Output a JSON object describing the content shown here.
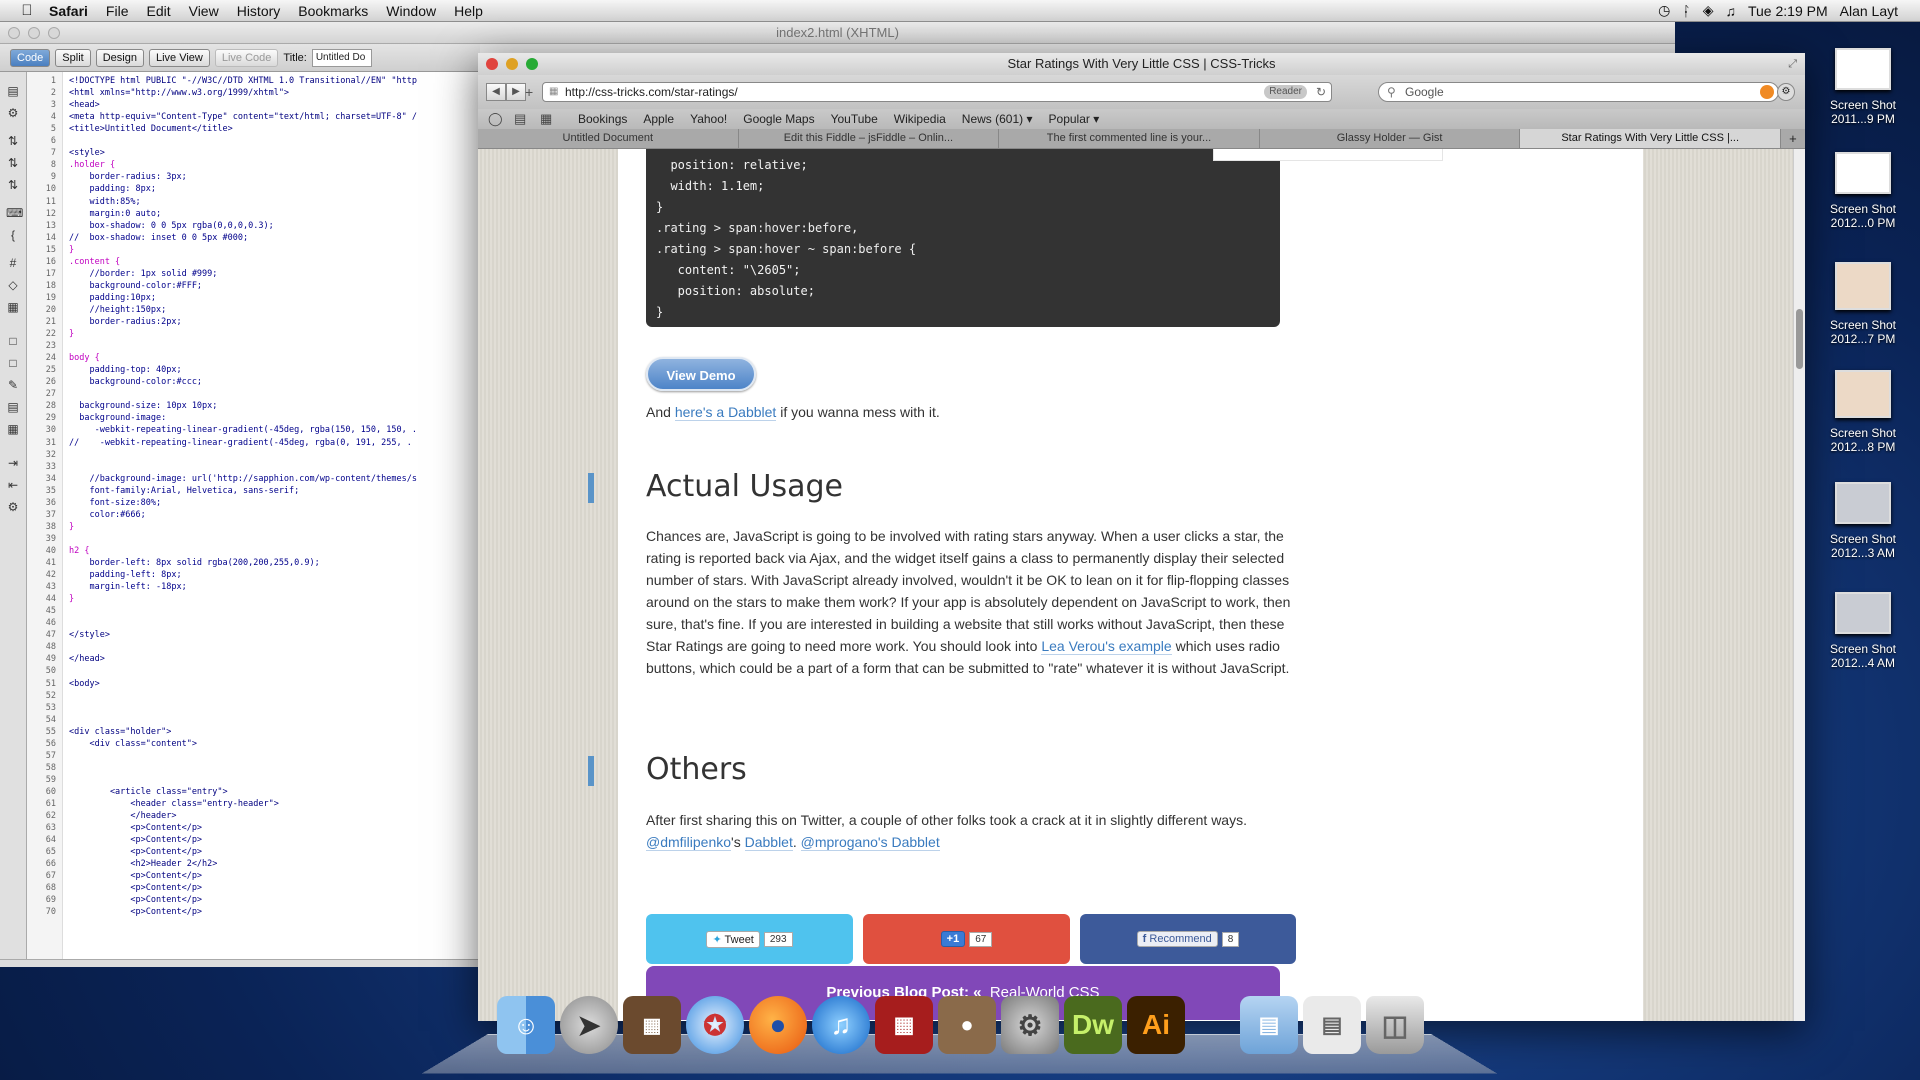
{
  "menubar": {
    "apple": "",
    "app": "Safari",
    "items": [
      "File",
      "Edit",
      "View",
      "History",
      "Bookmarks",
      "Window",
      "Help"
    ],
    "clock": "Tue 2:19 PM",
    "user": "Alan Layt"
  },
  "dreamweaver": {
    "title": "index2.html (XHTML)",
    "toolbar": {
      "code": "Code",
      "split": "Split",
      "design": "Design",
      "live_view": "Live View",
      "live_code": "Live Code",
      "title_label": "Title:",
      "title_value": "Untitled Do"
    },
    "line_numbers": [
      "1",
      "2",
      "3",
      "4",
      "5",
      "6",
      "7",
      "8",
      "9",
      "10",
      "11",
      "12",
      "13",
      "14",
      "15",
      "16",
      "17",
      "18",
      "19",
      "20",
      "21",
      "22",
      "23",
      "24",
      "25",
      "26",
      "27",
      "28",
      "29",
      "30",
      "31",
      "32",
      "33",
      "34",
      "35",
      "36",
      "37",
      "38",
      "39",
      "40",
      "41",
      "42",
      "43",
      "44",
      "45",
      "46",
      "47",
      "48",
      "49",
      "50",
      "51",
      "52",
      "53",
      "54",
      "55",
      "56",
      "57",
      "58",
      "59",
      "60",
      "61",
      "62",
      "63",
      "64",
      "65",
      "66",
      "67",
      "68",
      "69",
      "70"
    ],
    "code_lines": [
      "<!DOCTYPE html PUBLIC \"-//W3C//DTD XHTML 1.0 Transitional//EN\" \"http",
      "<html xmlns=\"http://www.w3.org/1999/xhtml\">",
      "<head>",
      "<meta http-equiv=\"Content-Type\" content=\"text/html; charset=UTF-8\" /",
      "<title>Untitled Document</title>",
      "",
      "<style>",
      ".holder {",
      "    border-radius: 3px;",
      "    padding: 8px;",
      "    width:85%;",
      "    margin:0 auto;",
      "    box-shadow: 0 0 5px rgba(0,0,0,0.3);",
      "//  box-shadow: inset 0 0 5px #000;",
      "}",
      ".content {",
      "    //border: 1px solid #999;",
      "    background-color:#FFF;",
      "    padding:10px;",
      "    //height:150px;",
      "    border-radius:2px;",
      "}",
      "",
      "body {",
      "    padding-top: 40px;",
      "    background-color:#ccc;",
      "",
      "  background-size: 10px 10px;",
      "  background-image:",
      "     -webkit-repeating-linear-gradient(-45deg, rgba(150, 150, 150, .",
      "//    -webkit-repeating-linear-gradient(-45deg, rgba(0, 191, 255, .",
      "",
      "",
      "    //background-image: url('http://sapphion.com/wp-content/themes/s",
      "    font-family:Arial, Helvetica, sans-serif;",
      "    font-size:80%;",
      "    color:#666;",
      "}",
      "",
      "h2 {",
      "    border-left: 8px solid rgba(200,200,255,0.9);",
      "    padding-left: 8px;",
      "    margin-left: -18px;",
      "}",
      "",
      "",
      "</style>",
      "",
      "</head>",
      "",
      "<body>",
      "",
      "",
      "",
      "<div class=\"holder\">",
      "    <div class=\"content\">",
      "",
      "",
      "",
      "        <article class=\"entry\">",
      "            <header class=\"entry-header\">",
      "            </header>",
      "            <p>Content</p>",
      "            <p>Content</p>",
      "            <p>Content</p>",
      "            <h2>Header 2</h2>",
      "            <p>Content</p>",
      "            <p>Content</p>",
      "            <p>Content</p>",
      "            <p>Content</p>"
    ]
  },
  "safari": {
    "title": "Star Ratings With Very Little CSS | CSS-Tricks",
    "url": "http://css-tricks.com/star-ratings/",
    "reader": "Reader",
    "search_placeholder": "Google",
    "bookmarks": [
      "Bookings",
      "Apple",
      "Yahoo!",
      "Google Maps",
      "YouTube",
      "Wikipedia",
      "News (601) ▾",
      "Popular ▾"
    ],
    "tabs": [
      "Untitled Document",
      "Edit this Fiddle – jsFiddle – Onlin...",
      "The first commented line is your...",
      "Glassy Holder — Gist",
      "Star Ratings With Very Little CSS |..."
    ],
    "active_tab": 4
  },
  "page": {
    "code_lines": [
      "  position: relative;",
      "  width: 1.1em;",
      "}",
      ".rating > span:hover:before,",
      ".rating > span:hover ~ span:before {",
      "   content: \"\\2605\";",
      "   position: absolute;",
      "}"
    ],
    "view_demo": "View Demo",
    "dabblet_pre": "And ",
    "dabblet_link": "here's a Dabblet",
    "dabblet_post": " if you wanna mess with it.",
    "h2_usage": "Actual Usage",
    "usage_p1": "Chances are, JavaScript is going to be involved with rating stars anyway. When a user clicks a star, the rating is reported back via Ajax, and the widget itself gains a class to permanently display their selected number of stars. With JavaScript already involved, wouldn't it be OK to lean on it for flip-flopping classes around on the stars to make them work? If your app is absolutely dependent on JavaScript to work, then sure, that's fine. If you are interested in building a website that still works without JavaScript, then these Star Ratings are going to need more work. You should look into ",
    "usage_link": "Lea Verou's example",
    "usage_p2": " which uses radio buttons, which could be a part of a form that can be submitted to \"rate\" whatever it is without JavaScript.",
    "h2_others": "Others",
    "others_p1": "After first sharing this on Twitter, a couple of other folks took a crack at it in slightly different ways.",
    "others_link1": "@dmfilipenko",
    "others_mid1": "'s ",
    "others_link2": "Dabblet",
    "others_mid2": ". ",
    "others_link3": "@mprogano's Dabblet",
    "tweet_label": "Tweet",
    "tweet_count": "293",
    "plus_label": "+1",
    "plus_count": "67",
    "fb_label": "Recommend",
    "fb_count": "8",
    "prev_label": "Previous Blog Post: «",
    "prev_link": "Real-World CSS"
  },
  "desktop_icons": [
    {
      "line1": "Screen Shot",
      "line2": "2011...9 PM"
    },
    {
      "line1": "Screen Shot",
      "line2": "2012...0 PM"
    },
    {
      "line1": "Screen Shot",
      "line2": "2012...7 PM"
    },
    {
      "line1": "Screen Shot",
      "line2": "2012...8 PM"
    },
    {
      "line1": "Screen Shot",
      "line2": "2012...3 AM"
    },
    {
      "line1": "Screen Shot",
      "line2": "2012...4 AM"
    }
  ],
  "dock": {
    "dw": "Dw",
    "ai": "Ai"
  },
  "colors": {
    "tweet": "#4fc3ee",
    "gplus": "#e0503f",
    "facebook": "#3d5a9a",
    "prev_post": "#8148b8",
    "h2_accent": "#5a94c8"
  }
}
